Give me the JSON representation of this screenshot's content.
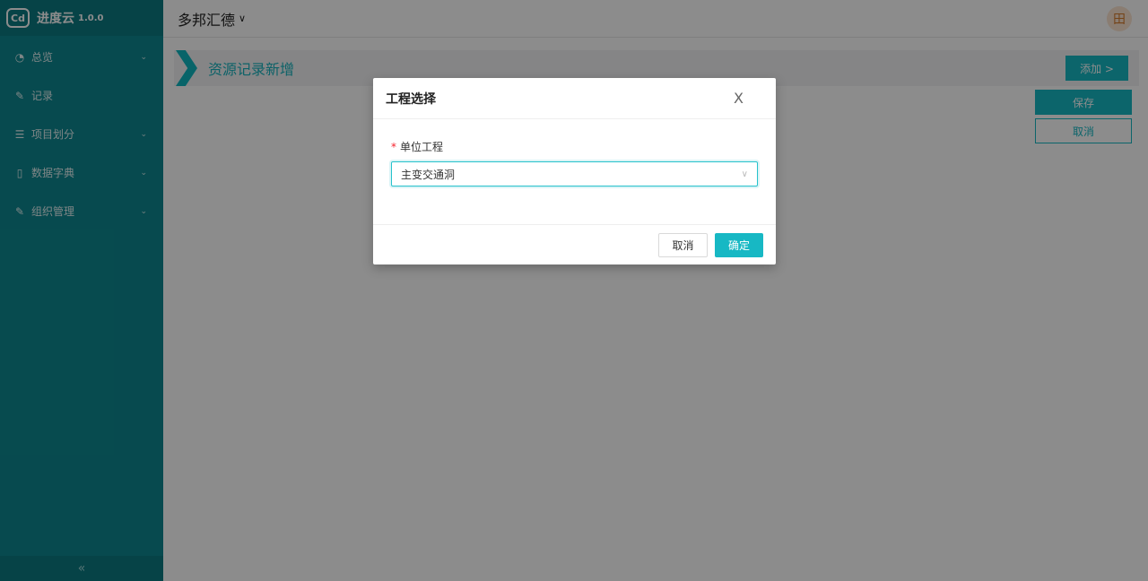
{
  "app": {
    "name": "进度云",
    "version": "1.0.0",
    "logo_text": "Cd"
  },
  "sidebar": {
    "items": [
      {
        "label": "总览",
        "icon": "pie-chart-icon",
        "glyph": "◔",
        "chevron": "⌄"
      },
      {
        "label": "记录",
        "icon": "edit-icon",
        "glyph": "✎",
        "chevron": ""
      },
      {
        "label": "项目划分",
        "icon": "list-icon",
        "glyph": "☰",
        "chevron": "⌄"
      },
      {
        "label": "数据字典",
        "icon": "file-icon",
        "glyph": "▯",
        "chevron": "⌄"
      },
      {
        "label": "组织管理",
        "icon": "edit-icon",
        "glyph": "✎",
        "chevron": "⌄"
      }
    ],
    "collapse_glyph": "«"
  },
  "header": {
    "org_name": "多邦汇德",
    "org_chevron": "∨",
    "avatar": "田"
  },
  "main": {
    "title": "资源记录新增",
    "add_button": "添加 >",
    "save_button": "保存",
    "cancel_button": "取消"
  },
  "modal": {
    "title": "工程选择",
    "close": "X",
    "field_label": "单位工程",
    "required_mark": "*",
    "select_value": "主变交通洞",
    "select_arrow": "∨",
    "cancel_button": "取消",
    "ok_button": "确定"
  },
  "colors": {
    "sidebar": "#0d8890",
    "accent": "#17b8c4",
    "required": "#f5222d"
  }
}
